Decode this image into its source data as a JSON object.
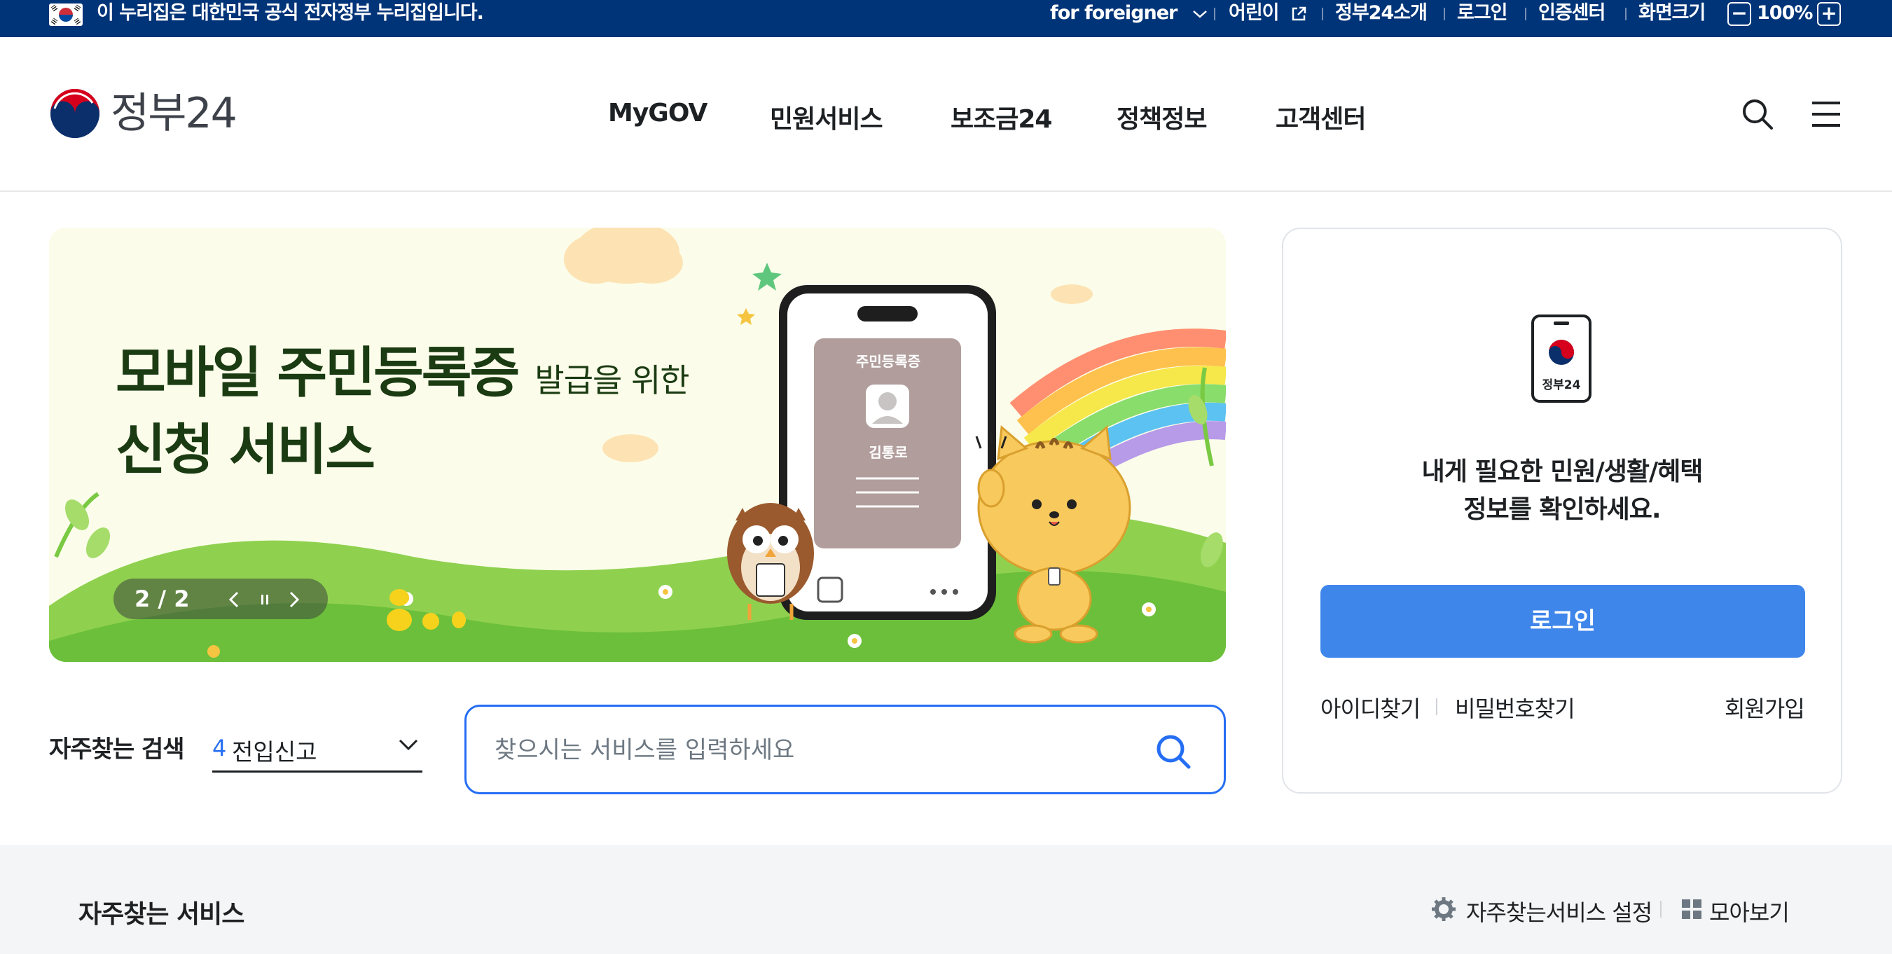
{
  "gov_banner": {
    "notice": "이 누리집은 대한민국 공식 전자정부 누리집입니다.",
    "utility": {
      "foreigner": "for foreigner",
      "kids": "어린이",
      "about": "정부24소개",
      "login": "로그인",
      "cert": "인증센터",
      "screen_size_label": "화면크기",
      "zoom_minus": "−",
      "zoom_level": "100%",
      "zoom_plus": "+"
    }
  },
  "header": {
    "logo_text": "정부24",
    "nav": [
      "MyGOV",
      "민원서비스",
      "보조금24",
      "정책정보",
      "고객센터"
    ],
    "icons": [
      "search-icon",
      "menu-icon"
    ]
  },
  "hero": {
    "title_line1": "모바일 주민등록증",
    "title_line1_small": "발급을 위한",
    "title_line2": "신청 서비스",
    "card_title": "주민등록증",
    "card_name": "김통로",
    "counter": "2 / 2"
  },
  "search": {
    "freq_label": "자주찾는 검색",
    "freq_rank": "4",
    "freq_value": "전입신고",
    "placeholder": "찾으시는 서비스를 입력하세요"
  },
  "login_card": {
    "phone_label": "정부24",
    "message_line1": "내게 필요한 민원/생활/혜택",
    "message_line2": "정보를 확인하세요.",
    "login_button": "로그인",
    "find_id": "아이디찾기",
    "find_password": "비밀번호찾기",
    "signup": "회원가입"
  },
  "frequent_services": {
    "title": "자주찾는 서비스",
    "settings": "자주찾는서비스 설정",
    "view_all": "모아보기"
  },
  "colors": {
    "banner_bg": "#003478",
    "primary": "#256ef4",
    "login_button": "#3f86eb",
    "hero_title": "#1b3b12"
  }
}
